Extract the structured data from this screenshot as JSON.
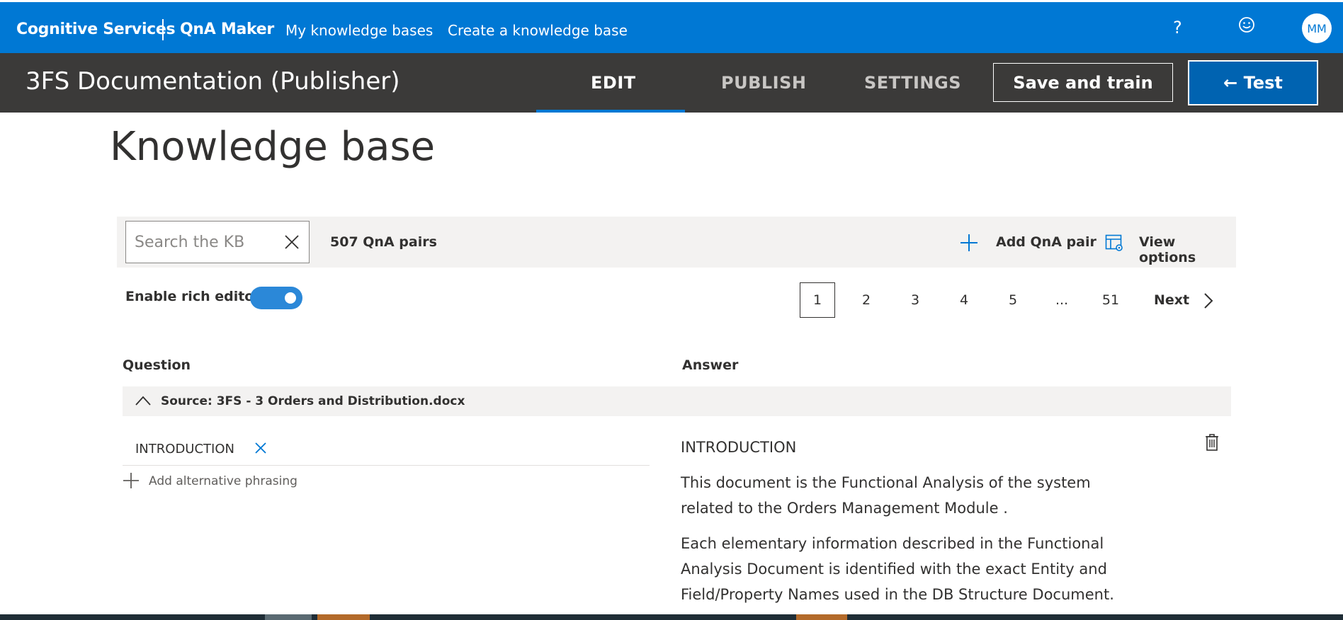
{
  "topbar": {
    "brand": "Cognitive Services",
    "product": "QnA Maker",
    "nav": [
      "My knowledge bases",
      "Create a knowledge base"
    ],
    "help": "?",
    "avatar_initials": "MM"
  },
  "titlebar": {
    "kb_title": "3FS Documentation (Publisher)",
    "tabs": [
      "EDIT",
      "PUBLISH",
      "SETTINGS"
    ],
    "active_tab": "EDIT",
    "save_label": "Save and train",
    "test_label": "← Test"
  },
  "page_title": "Knowledge base",
  "commandbar": {
    "search_placeholder": "Search the KB",
    "count_label": "507 QnA pairs",
    "add_label": "Add QnA pair",
    "view_label": "View options"
  },
  "rich_editor": {
    "label": "Enable rich editor",
    "enabled": true
  },
  "pagination": {
    "pages": [
      "1",
      "2",
      "3",
      "4",
      "5",
      "...",
      "51"
    ],
    "current": "1",
    "next_label": "Next"
  },
  "table": {
    "question_header": "Question",
    "answer_header": "Answer",
    "source_label": "Source: 3FS - 3 Orders and Distribution.docx",
    "question": "INTRODUCTION",
    "add_alt_label": "Add alternative phrasing",
    "answer_heading": "INTRODUCTION",
    "answer_paragraphs": [
      "This document is the Functional Analysis of the system related to the Orders Management Module .",
      "Each elementary information described in the Functional Analysis Document is identified with the exact Entity and Field/Property Names used in the DB Structure Document."
    ]
  },
  "colors": {
    "topbar": "#0078d4",
    "titlebar": "#3b3a39",
    "accent": "#0078d4",
    "test_button": "#0063b1",
    "toggle_on": "#2b88d8",
    "commandbar": "#f3f2f1"
  }
}
